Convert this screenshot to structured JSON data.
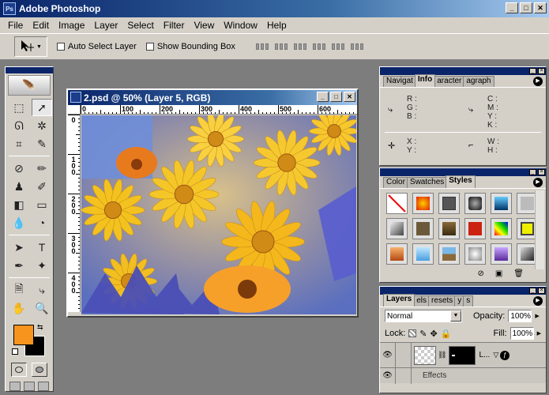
{
  "app": {
    "title": "Adobe Photoshop"
  },
  "window_controls": {
    "minimize": "_",
    "maximize": "□",
    "close": "✕"
  },
  "menu": [
    "File",
    "Edit",
    "Image",
    "Layer",
    "Select",
    "Filter",
    "View",
    "Window",
    "Help"
  ],
  "options": {
    "auto_select": "Auto Select Layer",
    "show_bounding_box": "Show Bounding Box"
  },
  "document": {
    "title": "2.psd @ 50% (Layer 5, RGB)",
    "ruler_top": [
      "0",
      "100",
      "200",
      "300",
      "400",
      "500",
      "600"
    ],
    "ruler_left": [
      "0",
      "100",
      "200",
      "300",
      "400"
    ]
  },
  "toolbox": {
    "foreground_color": "#f7941d",
    "background_color": "#000000"
  },
  "info_panel": {
    "tabs": [
      "Navigat",
      "Info",
      "aracter",
      "agraph"
    ],
    "rgb_labels": [
      "R :",
      "G :",
      "B :"
    ],
    "cmyk_labels": [
      "C :",
      "M :",
      "Y :",
      "K :"
    ],
    "xy_labels": [
      "X :",
      "Y :"
    ],
    "wh_labels": [
      "W :",
      "H :"
    ]
  },
  "styles_panel": {
    "tabs": [
      "Color",
      "Swatches",
      "Styles"
    ]
  },
  "layers_panel": {
    "tabs": [
      "Layers",
      "els",
      "resets",
      "y",
      "s"
    ],
    "blend_mode": "Normal",
    "opacity_label": "Opacity:",
    "opacity_value": "100%",
    "lock_label": "Lock:",
    "fill_label": "Fill:",
    "fill_value": "100%",
    "layer_name": "L...",
    "effects_label": "Effects"
  }
}
